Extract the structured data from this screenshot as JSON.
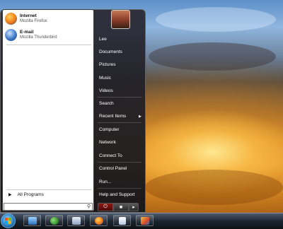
{
  "pinned": [
    {
      "title": "Internet",
      "subtitle": "Mozilla Firefox",
      "icon": "firefox-icon"
    },
    {
      "title": "E-mail",
      "subtitle": "Mozilla Thunderbird",
      "icon": "thunderbird-icon"
    }
  ],
  "all_programs_label": "All Programs",
  "search_placeholder": "",
  "right_items": [
    "Lee",
    "Documents",
    "Pictures",
    "Music",
    "Videos",
    "Search",
    "Recent Items",
    "Computer",
    "Network",
    "Connect To",
    "Control Panel",
    "Run...",
    "Help and Support"
  ],
  "power": {
    "shutdown_icon": "power-icon",
    "lock_icon": "lock-icon",
    "arrow_icon": "arrow-right-icon"
  },
  "taskbar_icons": [
    "windows-logo-icon",
    "show-desktop-icon",
    "network-people-icon",
    "explorer-icon",
    "firefox-icon",
    "document-icon",
    "paint-icon"
  ],
  "colors": {
    "accent": "#2b7fc4",
    "menu_bg": "#1c1c22"
  }
}
